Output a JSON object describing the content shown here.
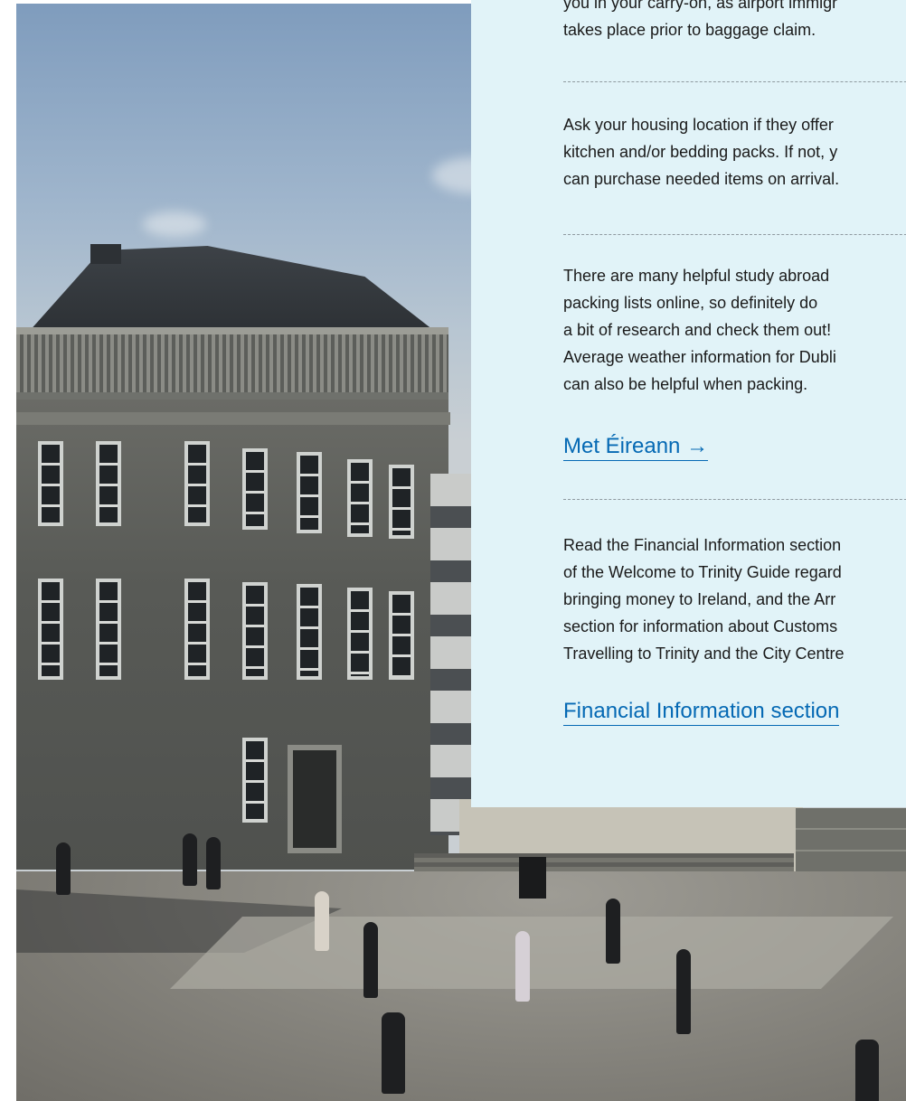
{
  "photo": {
    "icon": "trinity-college-square-photo"
  },
  "panel": {
    "blocks": [
      {
        "lines": [
          "you in your carry-on, as airport immigr",
          "takes place prior to baggage claim."
        ]
      },
      {
        "lines": [
          "Ask your housing location if they offer",
          "kitchen and/or bedding packs. If not, y",
          "can purchase needed items on arrival."
        ]
      },
      {
        "lines": [
          "There are many helpful study abroad",
          "packing lists online, so definitely do",
          "a bit of research and check them out!",
          "Average weather information for Dubli",
          "can also be helpful when packing."
        ],
        "link": "Met Éireann →"
      },
      {
        "lines": [
          "Read the Financial Information section",
          "of the Welcome to Trinity Guide regard",
          "bringing money to Ireland, and the Arr",
          "section for information about Customs",
          "Travelling to Trinity and the City Centre"
        ],
        "link": "Financial Information section"
      }
    ]
  },
  "colors": {
    "panel_background": "#e1f3f8",
    "link": "#0569b4",
    "text": "#1a1a1a"
  }
}
